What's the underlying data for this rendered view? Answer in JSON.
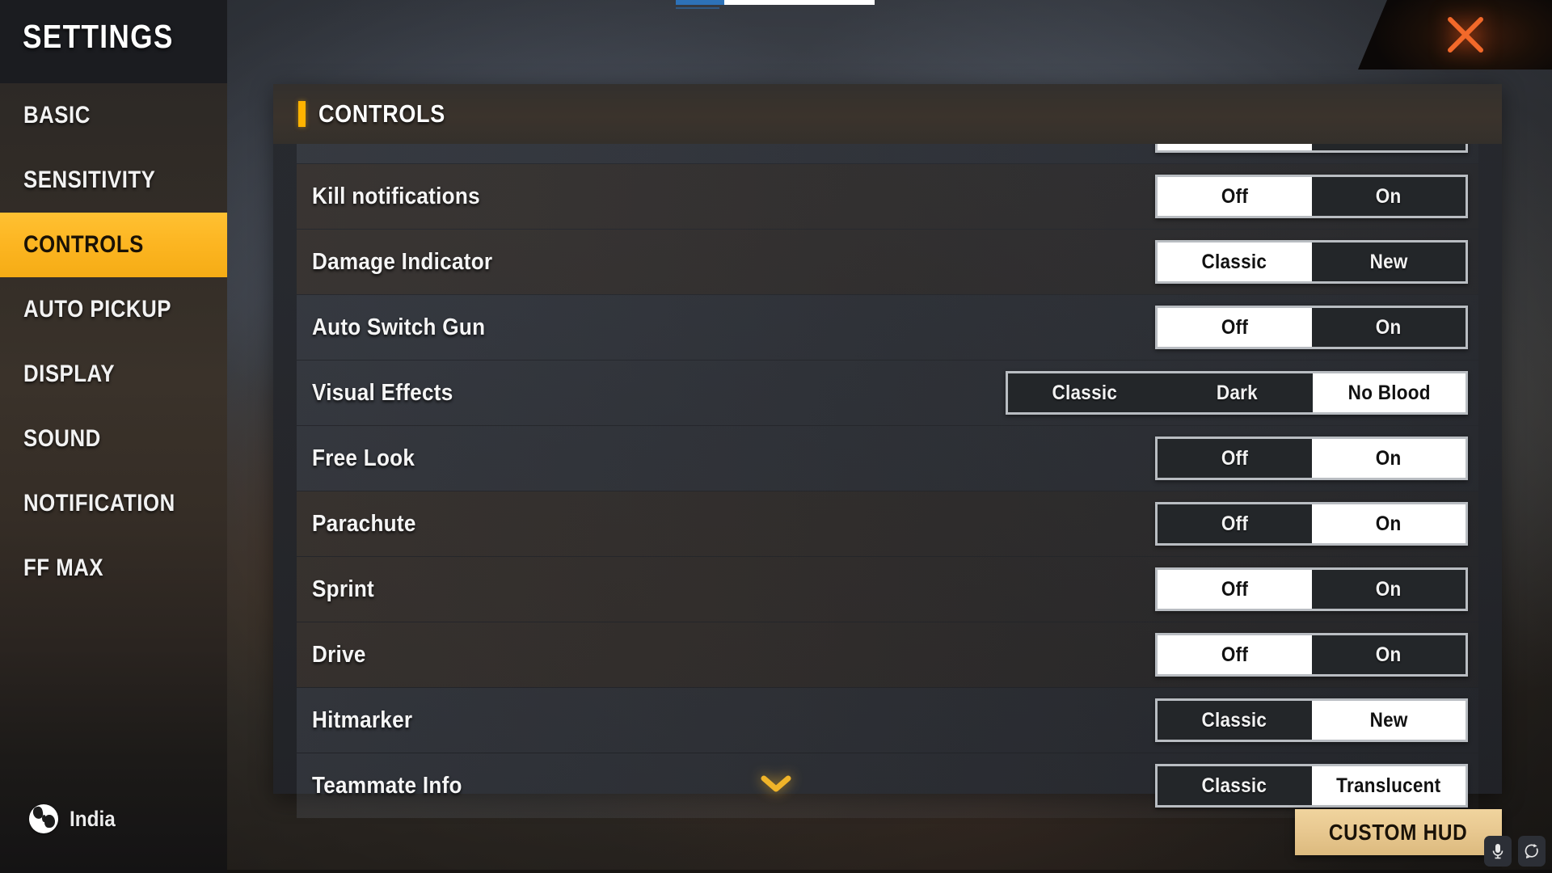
{
  "app": {
    "sidebar_title": "SETTINGS",
    "country": "India",
    "country_icon": "globe-icon"
  },
  "sidebar": {
    "items": [
      {
        "label": "BASIC",
        "active": false
      },
      {
        "label": "SENSITIVITY",
        "active": false
      },
      {
        "label": "CONTROLS",
        "active": true
      },
      {
        "label": "AUTO PICKUP",
        "active": false
      },
      {
        "label": "DISPLAY",
        "active": false
      },
      {
        "label": "SOUND",
        "active": false
      },
      {
        "label": "NOTIFICATION",
        "active": false
      },
      {
        "label": "FF MAX",
        "active": false
      }
    ]
  },
  "panel": {
    "title": "CONTROLS",
    "accent_color": "#ffb300"
  },
  "settings_rows": [
    {
      "label": "",
      "options": [
        "",
        ""
      ],
      "selected": 0,
      "clipped": true,
      "tone": "cool"
    },
    {
      "label": "Kill notifications",
      "options": [
        "Off",
        "On"
      ],
      "selected": 0,
      "clipped": false,
      "tone": "warm"
    },
    {
      "label": "Damage Indicator",
      "options": [
        "Classic",
        "New"
      ],
      "selected": 0,
      "clipped": false,
      "tone": "warm"
    },
    {
      "label": "Auto Switch Gun",
      "options": [
        "Off",
        "On"
      ],
      "selected": 0,
      "clipped": false,
      "tone": "cool"
    },
    {
      "label": "Visual Effects",
      "options": [
        "Classic",
        "Dark",
        "No Blood"
      ],
      "selected": 2,
      "clipped": false,
      "tone": "cool"
    },
    {
      "label": "Free Look",
      "options": [
        "Off",
        "On"
      ],
      "selected": 1,
      "clipped": false,
      "tone": "cool"
    },
    {
      "label": "Parachute",
      "options": [
        "Off",
        "On"
      ],
      "selected": 1,
      "clipped": false,
      "tone": "warm"
    },
    {
      "label": "Sprint",
      "options": [
        "Off",
        "On"
      ],
      "selected": 0,
      "clipped": false,
      "tone": "warm"
    },
    {
      "label": "Drive",
      "options": [
        "Off",
        "On"
      ],
      "selected": 0,
      "clipped": false,
      "tone": "warm"
    },
    {
      "label": "Hitmarker",
      "options": [
        "Classic",
        "New"
      ],
      "selected": 1,
      "clipped": false,
      "tone": "cool"
    },
    {
      "label": "Teammate Info",
      "options": [
        "Classic",
        "Translucent"
      ],
      "selected": 1,
      "clipped": false,
      "tone": "cool"
    }
  ],
  "footer": {
    "custom_hud_label": "CUSTOM HUD",
    "scroll_indicator": "chevron-down-icon"
  },
  "window": {
    "close_icon": "close-icon",
    "close_color": "#f2692a"
  },
  "system_icons": [
    {
      "name": "microphone-icon"
    },
    {
      "name": "refresh-circle-icon"
    }
  ],
  "loading_bar": {
    "progress_color": "#2d72b8",
    "track_color": "#ffffff"
  }
}
